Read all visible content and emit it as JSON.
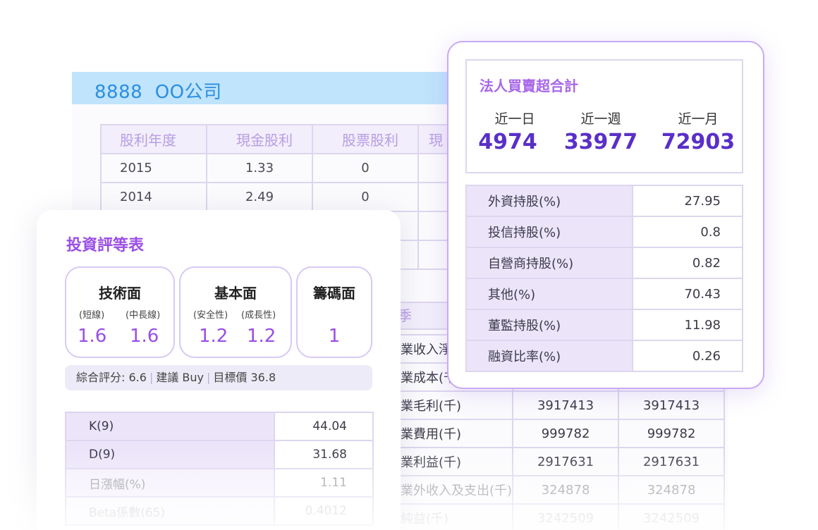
{
  "company": {
    "code": "8888",
    "name": "OO公司"
  },
  "dividend_table": {
    "headers": [
      "股利年度",
      "現金股利",
      "股票股利",
      "現"
    ],
    "rows": [
      [
        "2015",
        "1.33",
        "0"
      ],
      [
        "2014",
        "2.49",
        "0"
      ]
    ]
  },
  "financials": {
    "season_header": "季",
    "rows": [
      {
        "label": "業收入淨",
        "v1": "",
        "v2": ""
      },
      {
        "label": "業成本(千",
        "v1": "",
        "v2": ""
      },
      {
        "label": "業毛利(千)",
        "v1": "3917413",
        "v2": "3917413"
      },
      {
        "label": "業費用(千)",
        "v1": "999782",
        "v2": "999782"
      },
      {
        "label": "業利益(千)",
        "v1": "2917631",
        "v2": "2917631"
      },
      {
        "label": "業外收入及支出(千)",
        "v1": "324878",
        "v2": "324878"
      },
      {
        "label": "純益(千)",
        "v1": "3242509",
        "v2": "3242509"
      }
    ]
  },
  "rating": {
    "title": "投資評等表",
    "technical": {
      "name": "技術面",
      "sub1": "(短線)",
      "sub2": "(中長線)",
      "val1": "1.6",
      "val2": "1.6"
    },
    "fundamental": {
      "name": "基本面",
      "sub1": "(安全性)",
      "sub2": "(成長性)",
      "val1": "1.2",
      "val2": "1.2"
    },
    "chips": {
      "name": "籌碼面",
      "val": "1"
    },
    "summary": {
      "score": "綜合評分: 6.6",
      "recommend": "建議 Buy",
      "target": "目標價 36.8"
    },
    "indicators": [
      {
        "label": "K(9)",
        "value": "44.04"
      },
      {
        "label": "D(9)",
        "value": "31.68"
      },
      {
        "label": "日漲幅(%)",
        "value": "1.11"
      },
      {
        "label": "Beta係數(65)",
        "value": "0.4012"
      }
    ]
  },
  "institutional": {
    "title": "法人買賣超合計",
    "periods": [
      {
        "label": "近一日",
        "value": "4974"
      },
      {
        "label": "近一週",
        "value": "33977"
      },
      {
        "label": "近一月",
        "value": "72903"
      }
    ],
    "holdings": [
      {
        "label": "外資持股(%)",
        "value": "27.95"
      },
      {
        "label": "投信持股(%)",
        "value": "0.8"
      },
      {
        "label": "自營商持股(%)",
        "value": "0.82"
      },
      {
        "label": "其他(%)",
        "value": "70.43"
      },
      {
        "label": "董監持股(%)",
        "value": "11.98"
      },
      {
        "label": "融資比率(%)",
        "value": "0.26"
      }
    ]
  },
  "colors": {
    "accent": "#9a4ee6",
    "value_purple": "#5a2fc8",
    "company_blue": "#2c8ee0",
    "header_bar": "#bfe4fb"
  }
}
